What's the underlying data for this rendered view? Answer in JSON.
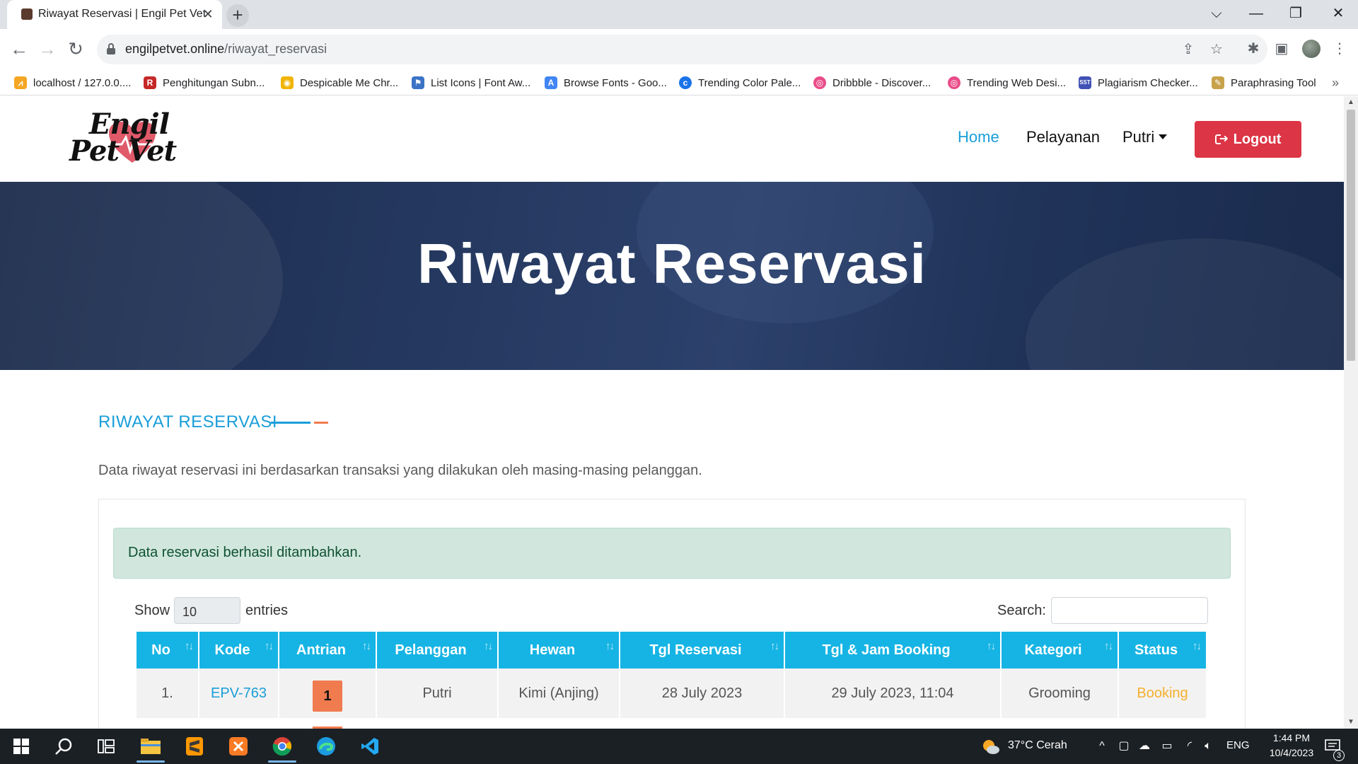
{
  "browser": {
    "tab_title": "Riwayat Reservasi | Engil Pet Vet",
    "url_host": "engilpetvet.online",
    "url_path": "/riwayat_reservasi",
    "bookmarks": [
      {
        "label": "localhost / 127.0.0....",
        "icon": "phpmyadmin-icon",
        "color": "#f5a623"
      },
      {
        "label": "Penghitungan Subn...",
        "icon": "subnet-icon",
        "color": "#c62828"
      },
      {
        "label": "Despicable Me Chr...",
        "icon": "minion-icon",
        "color": "#f0b400"
      },
      {
        "label": "List Icons | Font Aw...",
        "icon": "flag-icon",
        "color": "#3b73c7"
      },
      {
        "label": "Browse Fonts - Goo...",
        "icon": "google-fonts-icon",
        "color": "#4285f4"
      },
      {
        "label": "Trending Color Pale...",
        "icon": "coolors-icon",
        "color": "#1a73e8"
      },
      {
        "label": "Dribbble - Discover...",
        "icon": "dribbble-icon",
        "color": "#ea4c89"
      },
      {
        "label": "Trending Web Desi...",
        "icon": "dribbble-icon",
        "color": "#ea4c89"
      },
      {
        "label": "Plagiarism Checker...",
        "icon": "sst-icon",
        "color": "#3f51b5"
      },
      {
        "label": "Paraphrasing Tool",
        "icon": "paraphrase-icon",
        "color": "#c8a24a"
      }
    ]
  },
  "site": {
    "logo_line1": "Engil",
    "logo_line2": "Pet Vet",
    "nav": {
      "home": "Home",
      "services": "Pelayanan",
      "user": "Putri",
      "logout": "Logout"
    },
    "hero_title": "Riwayat Reservasi"
  },
  "content": {
    "section_title": "RIWAYAT RESERVASI",
    "description": "Data riwayat reservasi ini berdasarkan transaksi yang dilakukan oleh masing-masing pelanggan.",
    "alert": "Data reservasi berhasil ditambahkan.",
    "show_label": "Show",
    "entries_value": "10",
    "entries_label": "entries",
    "search_label": "Search:",
    "table": {
      "headers": [
        "No",
        "Kode",
        "Antrian",
        "Pelanggan",
        "Hewan",
        "Tgl Reservasi",
        "Tgl & Jam Booking",
        "Kategori",
        "Status"
      ],
      "rows": [
        {
          "no": "1.",
          "kode": "EPV-763",
          "antrian": "1",
          "pelanggan": "Putri",
          "hewan": "Kimi (Anjing)",
          "tgl_reservasi": "28 July 2023",
          "tgl_booking": "29 July 2023, 11:04",
          "kategori": "Grooming",
          "status": "Booking"
        }
      ]
    },
    "colors": {
      "accent": "#1a9ed9",
      "header_bg": "#16b4e4",
      "badge": "#f07b4f",
      "status_booking": "#f5b02e",
      "logout": "#dc3545"
    }
  },
  "taskbar": {
    "weather": "37°C  Cerah",
    "language": "ENG",
    "time": "1:44 PM",
    "date": "10/4/2023",
    "notifications": "3"
  }
}
